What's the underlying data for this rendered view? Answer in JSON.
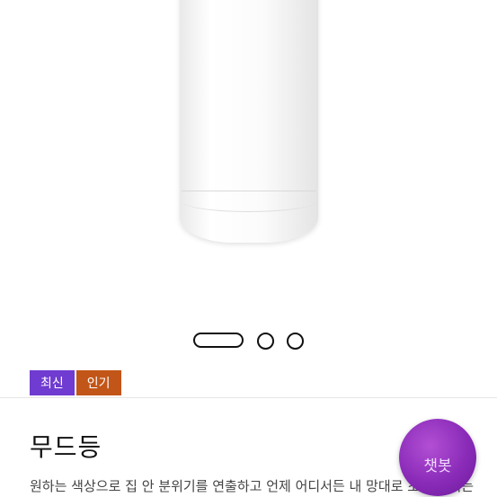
{
  "product": {
    "badges": {
      "new": "최신",
      "popular": "인기"
    },
    "title": "무드등",
    "description": "원하는 색상으로 집 안 분위기를 연출하고 언제 어디서든 내 망대로 조명을 켜는"
  },
  "carousel": {
    "current": 1,
    "total": 3
  },
  "chatbot": {
    "label": "챗봇"
  },
  "colors": {
    "badge_new": "#6f3bd0",
    "badge_popular": "#c25618",
    "chatbot": "#8a2bb8"
  }
}
